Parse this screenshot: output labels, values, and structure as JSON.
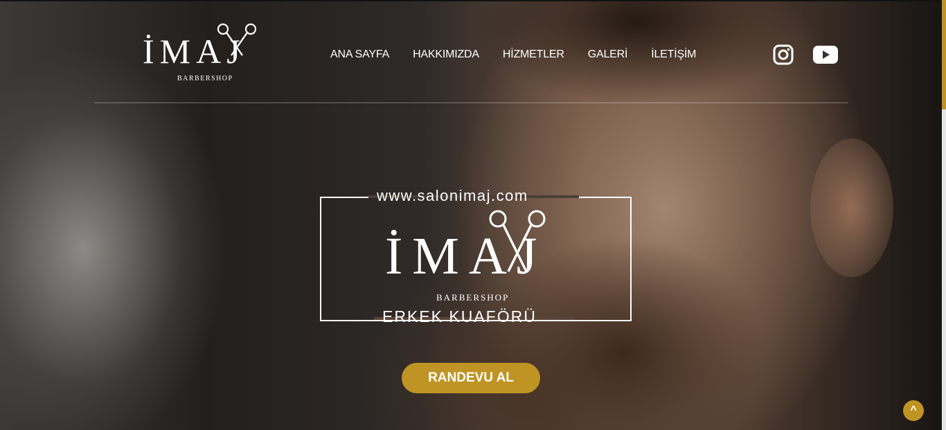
{
  "header": {
    "logo": {
      "main": "İMAJ",
      "sub": "BARBERSHOP"
    },
    "nav": [
      {
        "label": "ANA SAYFA"
      },
      {
        "label": "HAKKIMIZDA"
      },
      {
        "label": "HİZMETLER"
      },
      {
        "label": "GALERİ"
      },
      {
        "label": "İLETİŞİM"
      }
    ],
    "social": [
      {
        "icon": "instagram-icon"
      },
      {
        "icon": "youtube-icon"
      }
    ]
  },
  "hero": {
    "url": "www.salonimaj.com",
    "logo_main": "İMAJ",
    "logo_sub": "BARBERSHOP",
    "tagline": "ERKEK KUAFÖRÜ",
    "cta_label": "RANDEVU AL"
  },
  "back_to_top": {
    "label": "^"
  },
  "colors": {
    "accent": "#bf9424",
    "text": "#ffffff"
  }
}
